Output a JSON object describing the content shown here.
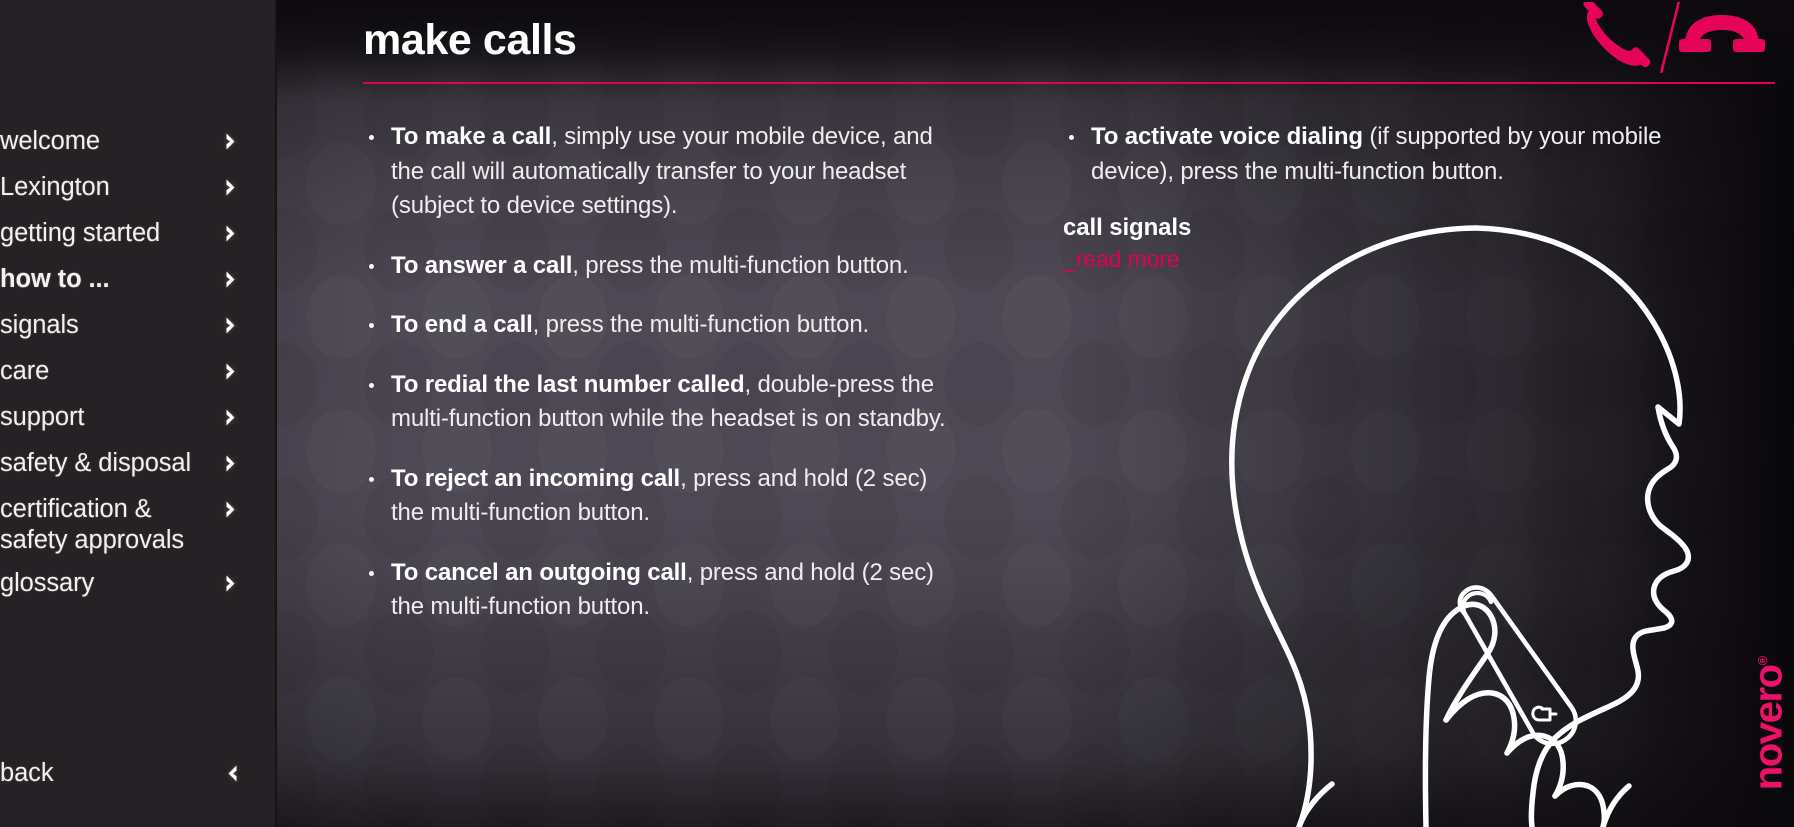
{
  "sidebar": {
    "items": [
      {
        "label": "welcome",
        "active": false,
        "icon": "chevron-right-icon"
      },
      {
        "label": "Lexington",
        "active": false,
        "icon": "chevron-right-icon"
      },
      {
        "label": "getting started",
        "active": false,
        "icon": "chevron-right-icon"
      },
      {
        "label": "how to ...",
        "active": true,
        "icon": "chevron-right-icon"
      },
      {
        "label": "signals",
        "active": false,
        "icon": "chevron-right-icon"
      },
      {
        "label": "care",
        "active": false,
        "icon": "chevron-right-icon"
      },
      {
        "label": "support",
        "active": false,
        "icon": "chevron-right-icon"
      },
      {
        "label": "safety & disposal",
        "active": false,
        "icon": "chevron-right-icon"
      },
      {
        "label": "certification &\nsafety approvals",
        "active": false,
        "icon": "chevron-right-icon"
      },
      {
        "label": "glossary",
        "active": false,
        "icon": "chevron-right-icon"
      }
    ],
    "back_label": "back",
    "back_icon": "chevron-left-icon"
  },
  "header": {
    "title": "make calls",
    "icons": [
      "phone-handset-icon",
      "phone-hangup-icon"
    ],
    "rule_color": "#e2004f"
  },
  "main": {
    "left_column": {
      "bullets": [
        {
          "lead": "To make a call",
          "rest": ", simply use your mobile device, and the call will automatically transfer to your headset (subject to device settings)."
        },
        {
          "lead": "To answer a call",
          "rest": ", press the multi-function button."
        },
        {
          "lead": "To end a call",
          "rest": ", press the multi-function button."
        },
        {
          "lead": "To redial the last number called",
          "rest": ", double-press the multi-function button while the headset is on standby."
        },
        {
          "lead": "To reject an incoming call",
          "rest": ", press and hold (2 sec) the multi-function button."
        },
        {
          "lead": "To cancel an outgoing call",
          "rest": ", press and hold (2 sec) the multi-function button."
        }
      ]
    },
    "right_column": {
      "bullets": [
        {
          "lead": "To activate voice dialing",
          "rest": " (if supported by your mobile device), press the multi-function button."
        }
      ],
      "section_heading": "call signals",
      "read_more_label": "_read more"
    },
    "illustration": "head-profile-with-headset-illustration"
  },
  "branding": {
    "logo_text": "novero",
    "logo_mark": "®",
    "logo_color": "#ee1169"
  },
  "colors": {
    "accent_pink": "#e2004f",
    "logo_pink": "#ee1169",
    "sidebar_bg": "#252124",
    "text": "#efedee"
  }
}
